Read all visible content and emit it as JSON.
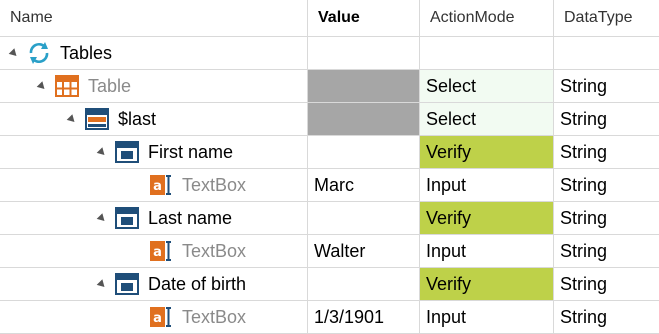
{
  "header": {
    "name": "Name",
    "value": "Value",
    "action_mode": "ActionMode",
    "data_type": "DataType"
  },
  "rows": [
    {
      "name": "Tables",
      "value": "",
      "action_mode": "",
      "data_type": "",
      "icon": "refresh-icon",
      "dim": false
    },
    {
      "name": "Table",
      "value": "",
      "action_mode": "Select",
      "data_type": "String",
      "icon": "table-icon",
      "dim": true
    },
    {
      "name": "$last",
      "value": "",
      "action_mode": "Select",
      "data_type": "String",
      "icon": "table-row-icon",
      "dim": false
    },
    {
      "name": "First name",
      "value": "",
      "action_mode": "Verify",
      "data_type": "String",
      "icon": "cell-icon",
      "dim": false
    },
    {
      "name": "TextBox",
      "value": "Marc",
      "action_mode": "Input",
      "data_type": "String",
      "icon": "textbox-icon",
      "dim": true
    },
    {
      "name": "Last name",
      "value": "",
      "action_mode": "Verify",
      "data_type": "String",
      "icon": "cell-icon",
      "dim": false
    },
    {
      "name": "TextBox",
      "value": "Walter",
      "action_mode": "Input",
      "data_type": "String",
      "icon": "textbox-icon",
      "dim": true
    },
    {
      "name": "Date of birth",
      "value": "",
      "action_mode": "Verify",
      "data_type": "String",
      "icon": "cell-icon",
      "dim": false
    },
    {
      "name": "TextBox",
      "value": "1/3/1901",
      "action_mode": "Input",
      "data_type": "String",
      "icon": "textbox-icon",
      "dim": true
    }
  ],
  "colors": {
    "verify_bg": "#bed149",
    "select_bg": "#f2fbf2",
    "value_gray": "#a6a6a6",
    "icon_blue": "#1f4e79",
    "icon_orange": "#e0701f"
  }
}
